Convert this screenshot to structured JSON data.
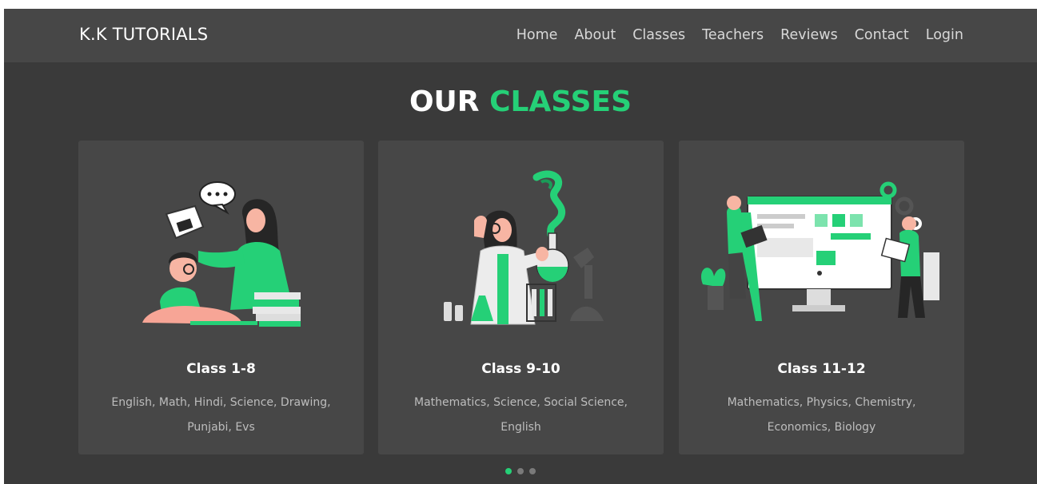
{
  "brand": "K.K TUTORIALS",
  "nav": [
    "Home",
    "About",
    "Classes",
    "Teachers",
    "Reviews",
    "Contact",
    "Login"
  ],
  "section": {
    "title_white": "OUR",
    "title_green": "CLASSES"
  },
  "cards": [
    {
      "title": "Class 1-8",
      "desc": "English, Math, Hindi, Science, Drawing, Punjabi, Evs",
      "icon": "kids-study-illustration"
    },
    {
      "title": "Class 9-10",
      "desc": "Mathematics, Science, Social Science, English",
      "icon": "lab-scientist-illustration"
    },
    {
      "title": "Class 11-12",
      "desc": "Mathematics, Physics, Chemistry, Economics, Biology",
      "icon": "web-development-illustration"
    }
  ],
  "carousel": {
    "total": 3,
    "active": 1
  },
  "colors": {
    "background": "#3a3a3a",
    "card": "#474747",
    "accent": "#25d077",
    "text": "#ffffff",
    "muted": "#bdbdbd"
  }
}
